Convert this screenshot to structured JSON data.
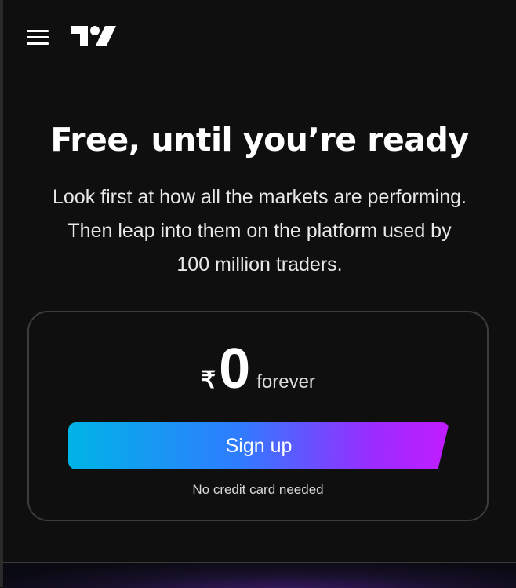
{
  "header": {
    "menu_icon": "hamburger-menu-icon",
    "logo": "tradingview-logo"
  },
  "hero": {
    "title": "Free, until you’re ready",
    "subtitle_lines": [
      "Look first at how all the markets are performing.",
      "Then leap into them on the platform used by",
      "100 million traders."
    ]
  },
  "pricing": {
    "currency_symbol": "₹",
    "amount": "0",
    "period": "forever",
    "signup_label": "Sign up",
    "note": "No credit card needed"
  },
  "colors": {
    "background": "#0f0f0f",
    "card_border": "#3c3c3c",
    "button_gradient": [
      "#00b4e6",
      "#2f7cff",
      "#9b2bff",
      "#c21cff"
    ]
  }
}
